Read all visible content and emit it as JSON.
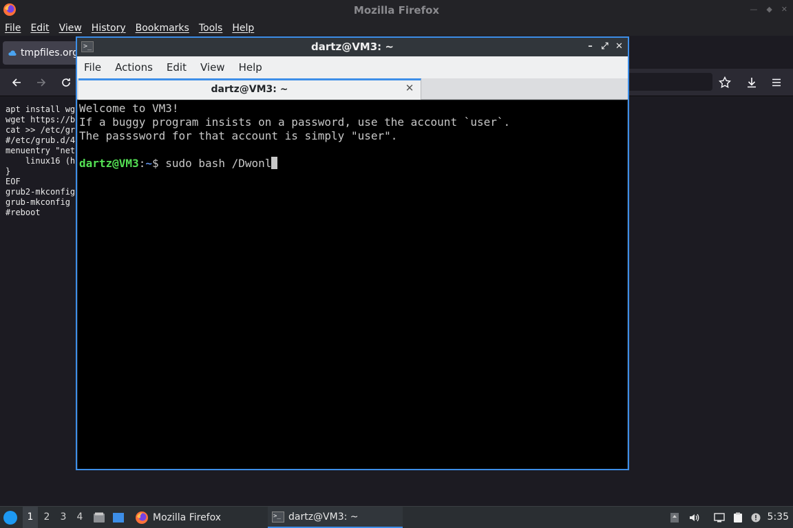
{
  "firefox": {
    "window_title": "Mozilla Firefox",
    "menu": [
      "File",
      "Edit",
      "View",
      "History",
      "Bookmarks",
      "Tools",
      "Help"
    ],
    "tab_label": "tmpfiles.org",
    "page_lines": [
      "apt install wg",
      "wget https://b",
      "cat >> /etc/gr",
      "#/etc/grub.d/4",
      "menuentry \"net",
      "    linux16 (h",
      "}",
      "EOF",
      "grub2-mkconfig",
      "grub-mkconfig",
      "#reboot"
    ]
  },
  "terminal": {
    "window_title": "dartz@VM3: ~",
    "menu": [
      "File",
      "Actions",
      "Edit",
      "View",
      "Help"
    ],
    "tab_label": "dartz@VM3: ~",
    "lines": [
      "Welcome to VM3!",
      "If a buggy program insists on a password, use the account `user`.",
      "The passsword for that account is simply \"user\"."
    ],
    "prompt_user": "dartz@VM3",
    "prompt_sep": ":",
    "prompt_path": "~",
    "prompt_symbol": "$ ",
    "command": "sudo bash /Dwonl"
  },
  "taskbar": {
    "workspaces": [
      "1",
      "2",
      "3",
      "4"
    ],
    "active_workspace": "1",
    "tasks": [
      {
        "label": "Mozilla Firefox",
        "icon": "firefox-icon"
      },
      {
        "label": "dartz@VM3: ~",
        "icon": "terminal-icon"
      }
    ],
    "clock": "5:35"
  },
  "colors": {
    "accent": "#3d8ee8",
    "prompt_user": "#54e054",
    "prompt_path": "#5c8ce0"
  }
}
